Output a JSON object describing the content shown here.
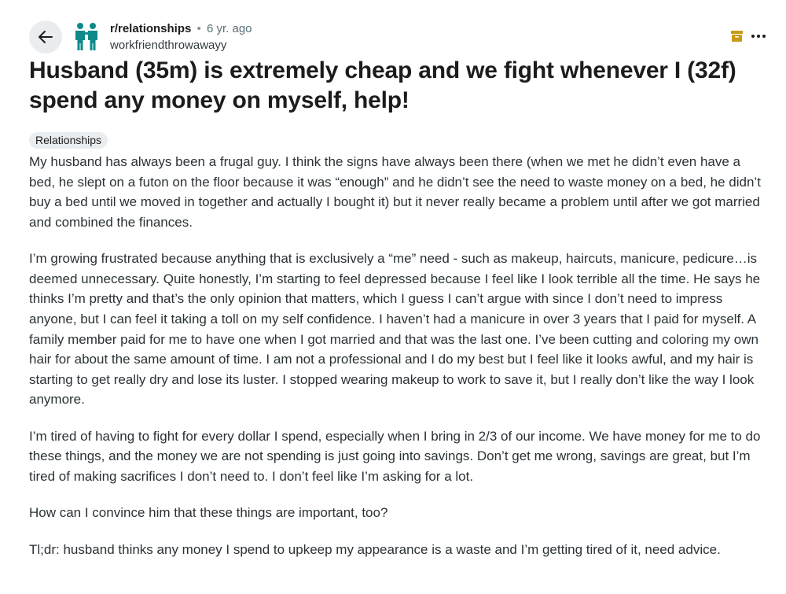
{
  "header": {
    "subreddit": "r/relationships",
    "separator": "•",
    "time_ago": "6 yr. ago",
    "author": "workfriendthrowawayy",
    "back_icon": "arrow-left-icon",
    "avatar_icon": "two-people-icon",
    "archive_icon": "archive-box-icon",
    "more_icon": "more-horizontal-icon"
  },
  "post": {
    "title": "Husband (35m) is extremely cheap and we fight whenever I (32f) spend any money on myself, help!",
    "flair": "Relationships",
    "paragraphs": [
      "My husband has always been a frugal guy. I think the signs have always been there (when we met he didn’t even have a bed, he slept on a futon on the floor because it was “enough” and he didn’t see the need to waste money on a bed, he didn’t buy a bed until we moved in together and actually I bought it) but it never really became a problem until after we got married and combined the finances.",
      "I’m growing frustrated because anything that is exclusively a “me” need - such as makeup, haircuts, manicure, pedicure…is deemed unnecessary. Quite honestly, I’m starting to feel depressed because I feel like I look terrible all the time. He says he thinks I’m pretty and that’s the only opinion that matters, which I guess I can’t argue with since I don’t need to impress anyone, but I can feel it taking a toll on my self confidence. I haven’t had a manicure in over 3 years that I paid for myself. A family member paid for me to have one when I got married and that was the last one. I’ve been cutting and coloring my own hair for about the same amount of time. I am not a professional and I do my best but I feel like it looks awful, and my hair is starting to get really dry and lose its luster. I stopped wearing makeup to work to save it, but I really don’t like the way I look anymore.",
      "I’m tired of having to fight for every dollar I spend, especially when I bring in 2/3 of our income. We have money for me to do these things, and the money we are not spending is just going into savings. Don’t get me wrong, savings are great, but I’m tired of making sacrifices I don’t need to. I don’t feel like I’m asking for a lot.",
      "How can I convince him that these things are important, too?",
      "Tl;dr: husband thinks any money I spend to upkeep my appearance is a waste and I’m getting tired of it, need advice."
    ]
  },
  "colors": {
    "subreddit_icon": "#0e8a8a",
    "archive_icon": "#c79a16",
    "button_bg": "#eaedef"
  }
}
